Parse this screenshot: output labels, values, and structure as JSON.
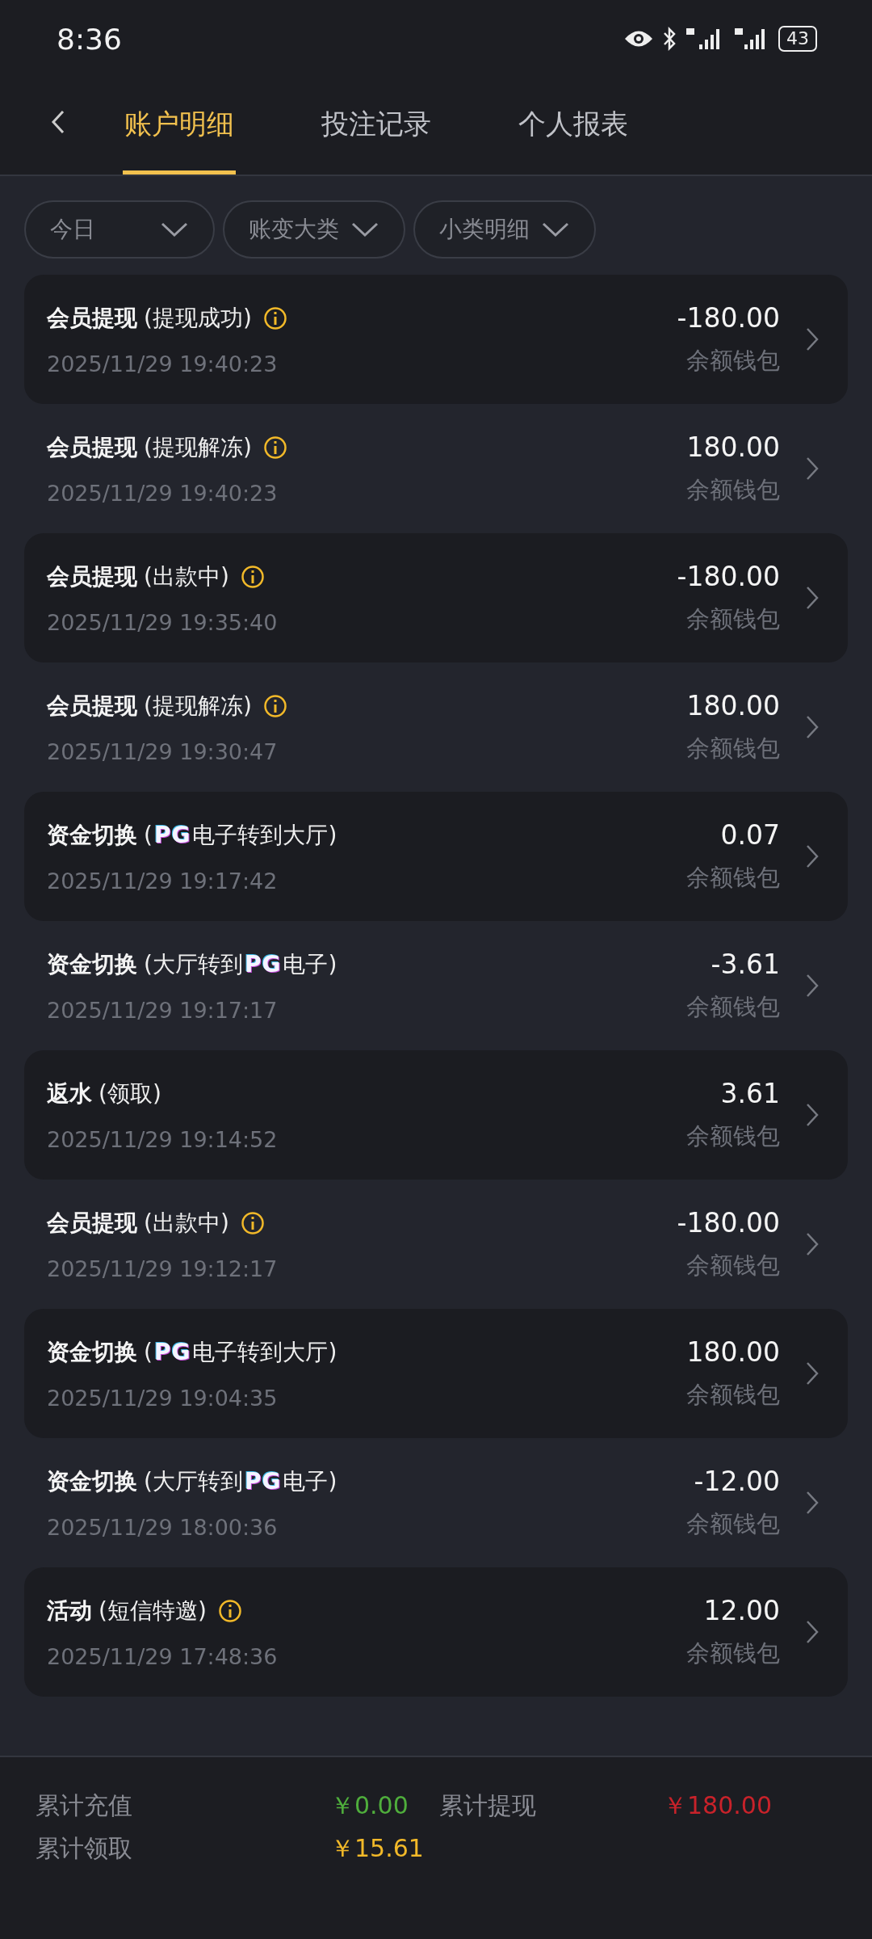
{
  "status_bar": {
    "time": "8:36",
    "battery": "43"
  },
  "tabs": [
    {
      "label": "账户明细",
      "selected": true
    },
    {
      "label": "投注记录",
      "selected": false
    },
    {
      "label": "个人报表",
      "selected": false
    }
  ],
  "filters": [
    "今日",
    "账变大类",
    "小类明细"
  ],
  "records": [
    {
      "title": "会员提现",
      "detail": [
        {
          "kind": "text",
          "text": "(提现成功)"
        }
      ],
      "info": true,
      "time": "2025/11/29 19:40:23",
      "amount": "-180.00",
      "wallet": "余额钱包"
    },
    {
      "title": "会员提现",
      "detail": [
        {
          "kind": "text",
          "text": "(提现解冻)"
        }
      ],
      "info": true,
      "time": "2025/11/29 19:40:23",
      "amount": "180.00",
      "wallet": "余额钱包"
    },
    {
      "title": "会员提现",
      "detail": [
        {
          "kind": "text",
          "text": "(出款中)"
        }
      ],
      "info": true,
      "time": "2025/11/29 19:35:40",
      "amount": "-180.00",
      "wallet": "余额钱包"
    },
    {
      "title": "会员提现",
      "detail": [
        {
          "kind": "text",
          "text": "(提现解冻)"
        }
      ],
      "info": true,
      "time": "2025/11/29 19:30:47",
      "amount": "180.00",
      "wallet": "余额钱包"
    },
    {
      "title": "资金切换",
      "detail": [
        {
          "kind": "text",
          "text": "("
        },
        {
          "kind": "logo",
          "text": "PG"
        },
        {
          "kind": "text",
          "text": "电子转到大厅)"
        }
      ],
      "info": false,
      "time": "2025/11/29 19:17:42",
      "amount": "0.07",
      "wallet": "余额钱包"
    },
    {
      "title": "资金切换",
      "detail": [
        {
          "kind": "text",
          "text": "(大厅转到"
        },
        {
          "kind": "logo",
          "text": "PG"
        },
        {
          "kind": "text",
          "text": "电子)"
        }
      ],
      "info": false,
      "time": "2025/11/29 19:17:17",
      "amount": "-3.61",
      "wallet": "余额钱包"
    },
    {
      "title": "返水",
      "detail": [
        {
          "kind": "text",
          "text": "(领取)"
        }
      ],
      "info": false,
      "time": "2025/11/29 19:14:52",
      "amount": "3.61",
      "wallet": "余额钱包"
    },
    {
      "title": "会员提现",
      "detail": [
        {
          "kind": "text",
          "text": "(出款中)"
        }
      ],
      "info": true,
      "time": "2025/11/29 19:12:17",
      "amount": "-180.00",
      "wallet": "余额钱包"
    },
    {
      "title": "资金切换",
      "detail": [
        {
          "kind": "text",
          "text": "("
        },
        {
          "kind": "logo",
          "text": "PG"
        },
        {
          "kind": "text",
          "text": "电子转到大厅)"
        }
      ],
      "info": false,
      "time": "2025/11/29 19:04:35",
      "amount": "180.00",
      "wallet": "余额钱包"
    },
    {
      "title": "资金切换",
      "detail": [
        {
          "kind": "text",
          "text": "(大厅转到"
        },
        {
          "kind": "logo",
          "text": "PG"
        },
        {
          "kind": "text",
          "text": "电子)"
        }
      ],
      "info": false,
      "time": "2025/11/29 18:00:36",
      "amount": "-12.00",
      "wallet": "余额钱包"
    },
    {
      "title": "活动",
      "detail": [
        {
          "kind": "text",
          "text": "(短信特邀)"
        }
      ],
      "info": true,
      "time": "2025/11/29 17:48:36",
      "amount": "12.00",
      "wallet": "余额钱包"
    }
  ],
  "summary": [
    {
      "label": "累计充值",
      "value": "￥0.00",
      "color": "#4fae3c"
    },
    {
      "label": "累计提现",
      "value": "￥180.00",
      "color": "#c8222a"
    },
    {
      "label": "累计领取",
      "value": "￥15.61",
      "color": "#f2b929"
    }
  ]
}
